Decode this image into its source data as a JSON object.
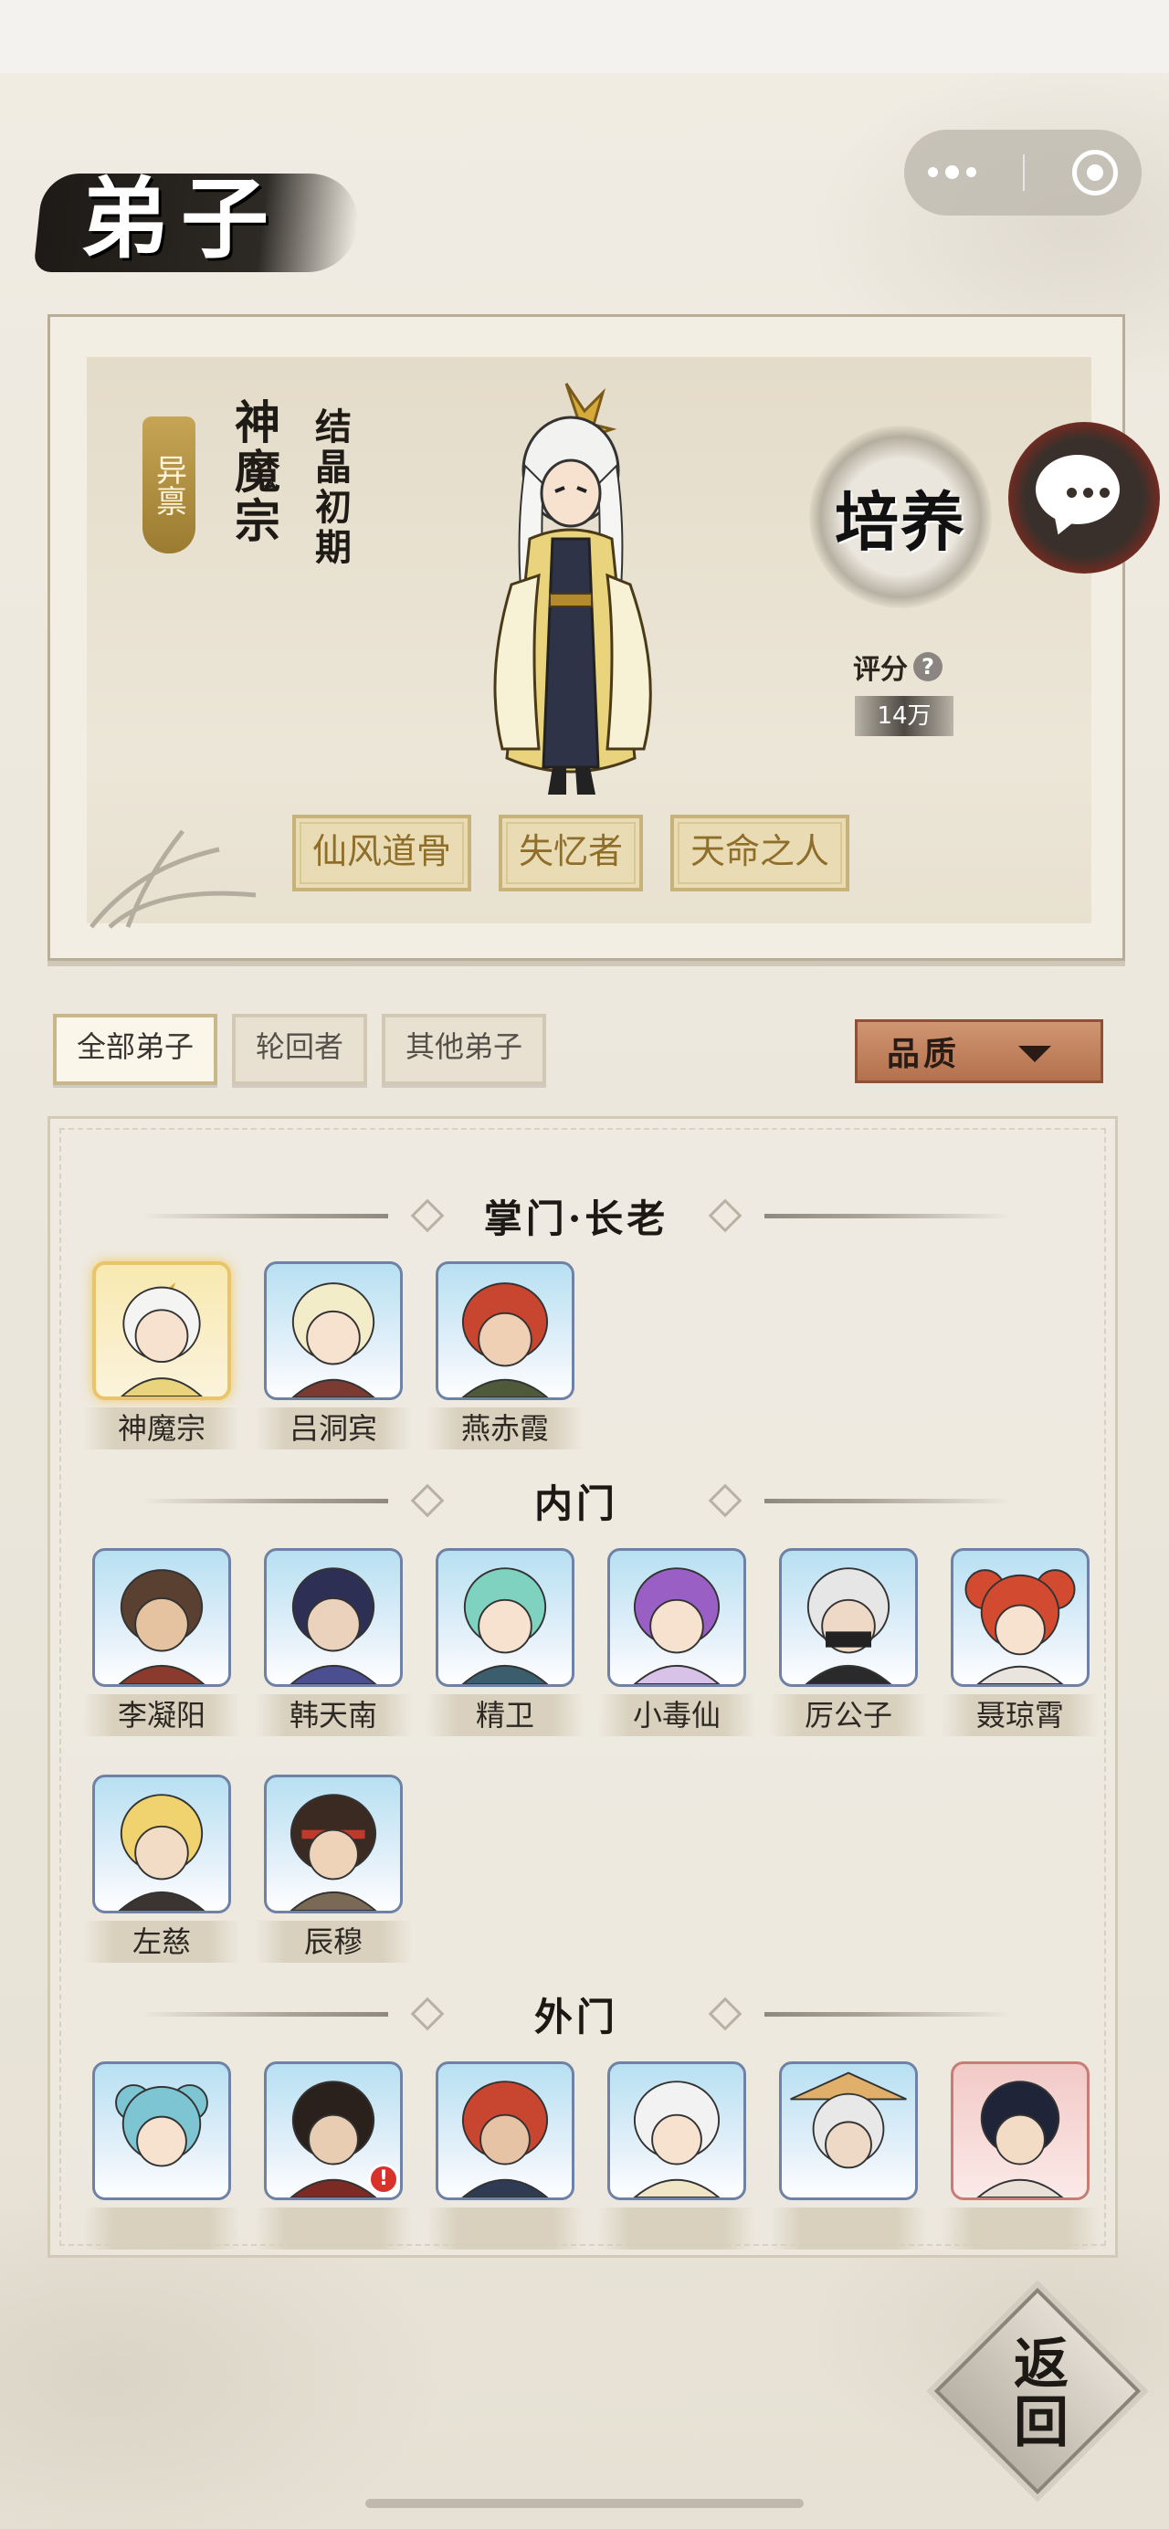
{
  "header": {
    "title": "弟子"
  },
  "featured": {
    "grade_badge": "异禀",
    "sect": "神魔宗",
    "realm": "结晶初期",
    "cultivate_label": "培养",
    "score_label": "评分",
    "score_help": "?",
    "score_value": "14万",
    "traits": [
      "仙风道骨",
      "失忆者",
      "天命之人"
    ]
  },
  "filters": {
    "tabs": [
      "全部弟子",
      "轮回者",
      "其他弟子"
    ],
    "active": 0,
    "sort_label": "品质"
  },
  "roster": {
    "sections": [
      {
        "title": "掌门·长老",
        "disciples": [
          "神魔宗",
          "吕洞宾",
          "燕赤霞"
        ]
      },
      {
        "title": "内门",
        "disciples": [
          "李凝阳",
          "韩天南",
          "精卫",
          "小毒仙",
          "厉公子",
          "聂琼霄",
          "左慈",
          "辰穆"
        ]
      },
      {
        "title": "外门",
        "disciples": [
          "",
          "",
          "",
          "",
          "",
          ""
        ]
      }
    ]
  },
  "back_label": "返回",
  "colors": {
    "accent_gold": "#c7b27a",
    "sort_button": "#b4714d",
    "card_border": "#6f82a6"
  }
}
